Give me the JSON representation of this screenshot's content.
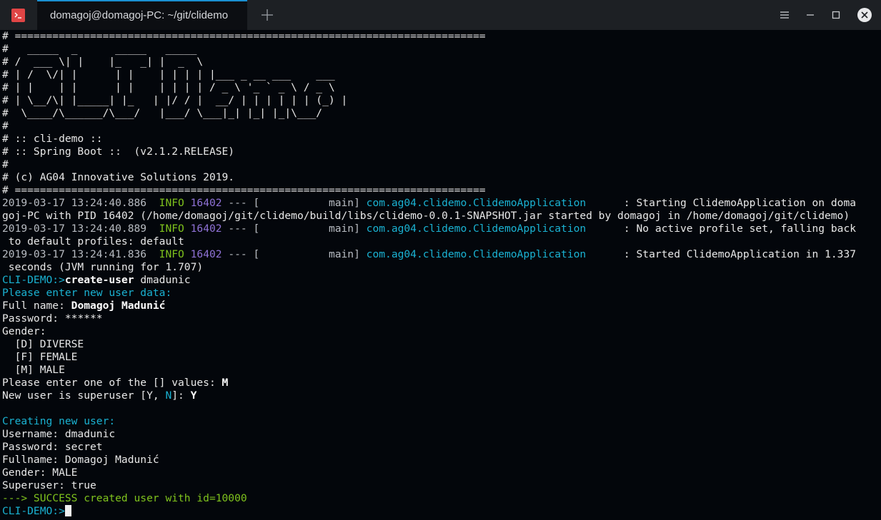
{
  "window": {
    "tab_title": "domagoj@domagoj-PC: ~/git/clidemo"
  },
  "banner": {
    "rule": "# ===========================================================================",
    "art": [
      "#   _____  _      _____   _____",
      "# /  ___ \\| |    |_   _| |  _  \\",
      "# | /  \\/| |      | |    | | | | |___ _ __ ___    ___",
      "# | |    | |      | |    | | | | / _ \\ '_ ` _ \\ / _ \\",
      "# | \\__/\\| |_____| |_   | |/ / |  __/ | | | | | | (_) |",
      "#  \\____/\\______/\\___/   |___/ \\___|_| |_| |_|\\___/"
    ],
    "hash": "#",
    "app_name": "# :: cli-demo ::",
    "spring": "# :: Spring Boot ::  (v2.1.2.RELEASE)",
    "copyright": "# (c) AG04 Innovative Solutions 2019."
  },
  "logs": [
    {
      "timestamp": "2019-03-17 13:24:40.886",
      "level": "INFO",
      "pid": "16402",
      "sep": "--- [           main]",
      "logger": "com.ag04.clidemo.ClidemoApplication",
      "message": ": Starting ClidemoApplication on doma",
      "wrap": "goj-PC with PID 16402 (/home/domagoj/git/clidemo/build/libs/clidemo-0.0.1-SNAPSHOT.jar started by domagoj in /home/domagoj/git/clidemo)"
    },
    {
      "timestamp": "2019-03-17 13:24:40.889",
      "level": "INFO",
      "pid": "16402",
      "sep": "--- [           main]",
      "logger": "com.ag04.clidemo.ClidemoApplication",
      "message": ": No active profile set, falling back",
      "wrap": " to default profiles: default"
    },
    {
      "timestamp": "2019-03-17 13:24:41.836",
      "level": "INFO",
      "pid": "16402",
      "sep": "--- [           main]",
      "logger": "com.ag04.clidemo.ClidemoApplication",
      "message": ": Started ClidemoApplication in 1.337",
      "wrap": " seconds (JVM running for 1.707)"
    }
  ],
  "session": {
    "prompt": "CLI-DEMO:>",
    "command": "create-user",
    "command_arg": "dmadunic",
    "enter_data": "Please enter new user data:",
    "fullname_label": "Full name:",
    "fullname_value": "Domagoj Madunić",
    "password_label": "Password:",
    "password_value": "******",
    "gender_label": "Gender:",
    "gender_options": [
      "  [D] DIVERSE",
      "  [F] FEMALE",
      "  [M] MALE"
    ],
    "enter_one": "Please enter one of the [] values:",
    "enter_one_value": "M",
    "superuser_prefix": "New user is superuser [Y, ",
    "superuser_n": "N",
    "superuser_suffix": "]:",
    "superuser_value": "Y",
    "creating": "Creating new user:",
    "result": [
      "Username: dmadunic",
      "Password: secret",
      "Fullname: Domagoj Madunić",
      "Gender: MALE",
      "Superuser: true"
    ],
    "success": "---> SUCCESS created user with id=10000",
    "final_prompt": "CLI-DEMO:>"
  }
}
